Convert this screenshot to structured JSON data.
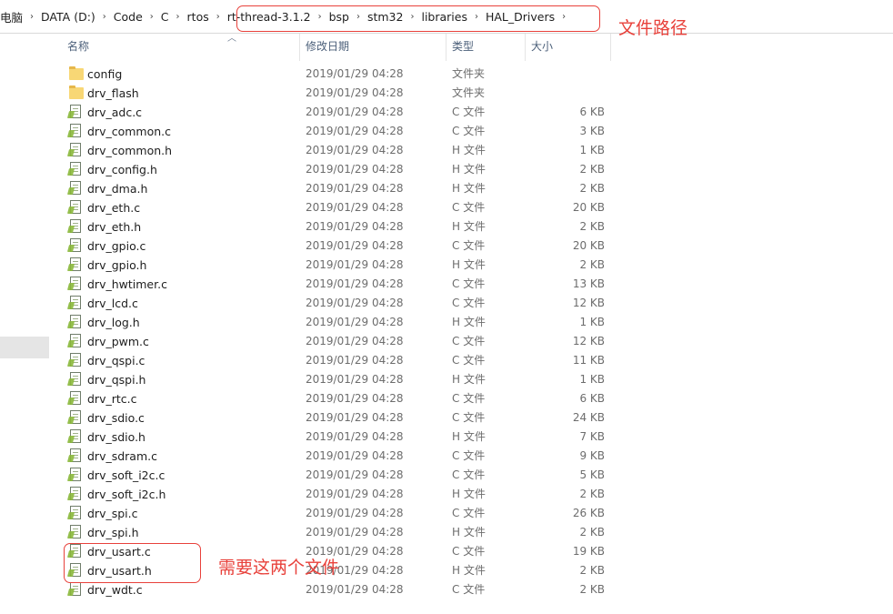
{
  "breadcrumb": [
    "电脑",
    "DATA (D:)",
    "Code",
    "C",
    "rtos",
    "rt-thread-3.1.2",
    "bsp",
    "stm32",
    "libraries",
    "HAL_Drivers"
  ],
  "annotations": {
    "path_label": "文件路径",
    "files_label": "需要这两个文件",
    "color": "#e8413b"
  },
  "columns": {
    "name": "名称",
    "date": "修改日期",
    "type": "类型",
    "size": "大小"
  },
  "files": [
    {
      "name": "config",
      "date": "2019/01/29 04:28",
      "type": "文件夹",
      "size": "",
      "kind": "folder"
    },
    {
      "name": "drv_flash",
      "date": "2019/01/29 04:28",
      "type": "文件夹",
      "size": "",
      "kind": "folder"
    },
    {
      "name": "drv_adc.c",
      "date": "2019/01/29 04:28",
      "type": "C 文件",
      "size": "6 KB",
      "kind": "file"
    },
    {
      "name": "drv_common.c",
      "date": "2019/01/29 04:28",
      "type": "C 文件",
      "size": "3 KB",
      "kind": "file"
    },
    {
      "name": "drv_common.h",
      "date": "2019/01/29 04:28",
      "type": "H 文件",
      "size": "1 KB",
      "kind": "file"
    },
    {
      "name": "drv_config.h",
      "date": "2019/01/29 04:28",
      "type": "H 文件",
      "size": "2 KB",
      "kind": "file"
    },
    {
      "name": "drv_dma.h",
      "date": "2019/01/29 04:28",
      "type": "H 文件",
      "size": "2 KB",
      "kind": "file"
    },
    {
      "name": "drv_eth.c",
      "date": "2019/01/29 04:28",
      "type": "C 文件",
      "size": "20 KB",
      "kind": "file"
    },
    {
      "name": "drv_eth.h",
      "date": "2019/01/29 04:28",
      "type": "H 文件",
      "size": "2 KB",
      "kind": "file"
    },
    {
      "name": "drv_gpio.c",
      "date": "2019/01/29 04:28",
      "type": "C 文件",
      "size": "20 KB",
      "kind": "file"
    },
    {
      "name": "drv_gpio.h",
      "date": "2019/01/29 04:28",
      "type": "H 文件",
      "size": "2 KB",
      "kind": "file"
    },
    {
      "name": "drv_hwtimer.c",
      "date": "2019/01/29 04:28",
      "type": "C 文件",
      "size": "13 KB",
      "kind": "file"
    },
    {
      "name": "drv_lcd.c",
      "date": "2019/01/29 04:28",
      "type": "C 文件",
      "size": "12 KB",
      "kind": "file"
    },
    {
      "name": "drv_log.h",
      "date": "2019/01/29 04:28",
      "type": "H 文件",
      "size": "1 KB",
      "kind": "file"
    },
    {
      "name": "drv_pwm.c",
      "date": "2019/01/29 04:28",
      "type": "C 文件",
      "size": "12 KB",
      "kind": "file"
    },
    {
      "name": "drv_qspi.c",
      "date": "2019/01/29 04:28",
      "type": "C 文件",
      "size": "11 KB",
      "kind": "file"
    },
    {
      "name": "drv_qspi.h",
      "date": "2019/01/29 04:28",
      "type": "H 文件",
      "size": "1 KB",
      "kind": "file"
    },
    {
      "name": "drv_rtc.c",
      "date": "2019/01/29 04:28",
      "type": "C 文件",
      "size": "6 KB",
      "kind": "file"
    },
    {
      "name": "drv_sdio.c",
      "date": "2019/01/29 04:28",
      "type": "C 文件",
      "size": "24 KB",
      "kind": "file"
    },
    {
      "name": "drv_sdio.h",
      "date": "2019/01/29 04:28",
      "type": "H 文件",
      "size": "7 KB",
      "kind": "file"
    },
    {
      "name": "drv_sdram.c",
      "date": "2019/01/29 04:28",
      "type": "C 文件",
      "size": "9 KB",
      "kind": "file"
    },
    {
      "name": "drv_soft_i2c.c",
      "date": "2019/01/29 04:28",
      "type": "C 文件",
      "size": "5 KB",
      "kind": "file"
    },
    {
      "name": "drv_soft_i2c.h",
      "date": "2019/01/29 04:28",
      "type": "H 文件",
      "size": "2 KB",
      "kind": "file"
    },
    {
      "name": "drv_spi.c",
      "date": "2019/01/29 04:28",
      "type": "C 文件",
      "size": "26 KB",
      "kind": "file"
    },
    {
      "name": "drv_spi.h",
      "date": "2019/01/29 04:28",
      "type": "H 文件",
      "size": "2 KB",
      "kind": "file"
    },
    {
      "name": "drv_usart.c",
      "date": "2019/01/29 04:28",
      "type": "C 文件",
      "size": "19 KB",
      "kind": "file"
    },
    {
      "name": "drv_usart.h",
      "date": "2019/01/29 04:28",
      "type": "H 文件",
      "size": "2 KB",
      "kind": "file"
    },
    {
      "name": "drv_wdt.c",
      "date": "2019/01/29 04:28",
      "type": "C 文件",
      "size": "2 KB",
      "kind": "file"
    }
  ]
}
